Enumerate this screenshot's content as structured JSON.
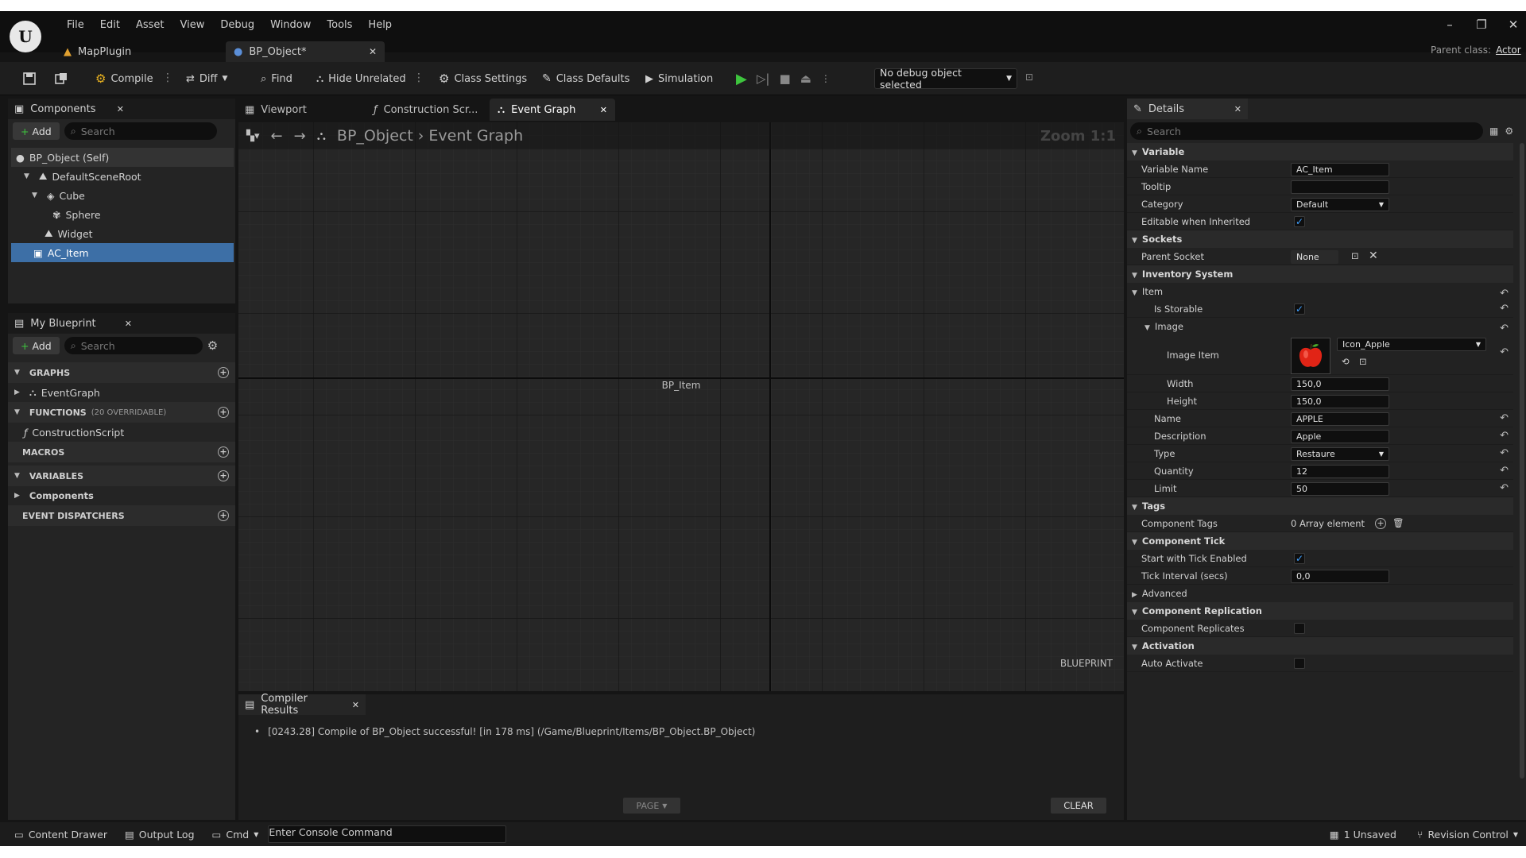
{
  "menu": [
    "File",
    "Edit",
    "Asset",
    "View",
    "Debug",
    "Window",
    "Tools",
    "Help"
  ],
  "tabs": {
    "map_plugin": "MapPlugin",
    "bp_object": "BP_Object*"
  },
  "parent_class": {
    "label": "Parent class:",
    "value": "Actor"
  },
  "toolbar": {
    "compile": "Compile",
    "diff": "Diff",
    "find": "Find",
    "hide_unrelated": "Hide Unrelated",
    "class_settings": "Class Settings",
    "class_defaults": "Class Defaults",
    "simulation": "Simulation",
    "debug_select": "No debug object selected"
  },
  "components": {
    "title": "Components",
    "add": "Add",
    "search_placeholder": "Search",
    "tree": [
      "BP_Object (Self)",
      "DefaultSceneRoot",
      "Cube",
      "Sphere",
      "Widget",
      "AC_Item"
    ]
  },
  "my_blueprint": {
    "title": "My Blueprint",
    "add": "Add",
    "search_placeholder": "Search",
    "graphs": "GRAPHS",
    "event_graph": "EventGraph",
    "functions": "FUNCTIONS",
    "functions_count": "(20 OVERRIDABLE)",
    "construction_script": "ConstructionScript",
    "macros": "MACROS",
    "variables": "VARIABLES",
    "components": "Components",
    "event_dispatchers": "EVENT DISPATCHERS"
  },
  "editor_tabs": {
    "viewport": "Viewport",
    "construction": "Construction Scr...",
    "event_graph": "Event Graph"
  },
  "graph": {
    "breadcrumb_root": "BP_Object",
    "breadcrumb_leaf": "Event Graph",
    "zoom": "Zoom 1:1",
    "watermark": "BP_Item",
    "corner": "BLUEPRINT"
  },
  "compiler": {
    "title": "Compiler Results",
    "message": "[0243.28] Compile of BP_Object successful! [in 178 ms] (/Game/Blueprint/Items/BP_Object.BP_Object)",
    "page": "PAGE",
    "clear": "CLEAR"
  },
  "details": {
    "title": "Details",
    "search_placeholder": "Search",
    "variable": "Variable",
    "variable_name_label": "Variable Name",
    "variable_name": "AC_Item",
    "tooltip_label": "Tooltip",
    "tooltip": "",
    "category_label": "Category",
    "category": "Default",
    "editable_label": "Editable when Inherited",
    "sockets": "Sockets",
    "parent_socket_label": "Parent Socket",
    "parent_socket": "None",
    "inventory": "Inventory System",
    "item": "Item",
    "is_storable": "Is Storable",
    "image": "Image",
    "image_item_label": "Image Item",
    "image_item": "Icon_Apple",
    "width_label": "Width",
    "width": "150,0",
    "height_label": "Height",
    "height": "150,0",
    "name_label": "Name",
    "name": "APPLE",
    "description_label": "Description",
    "description": "Apple",
    "type_label": "Type",
    "type": "Restaure",
    "quantity_label": "Quantity",
    "quantity": "12",
    "limit_label": "Limit",
    "limit": "50",
    "tags": "Tags",
    "component_tags_label": "Component Tags",
    "component_tags": "0 Array element",
    "component_tick": "Component Tick",
    "start_tick_label": "Start with Tick Enabled",
    "tick_interval_label": "Tick Interval (secs)",
    "tick_interval": "0,0",
    "advanced": "Advanced",
    "replication": "Component Replication",
    "replicates_label": "Component Replicates",
    "activation": "Activation",
    "auto_activate_label": "Auto Activate"
  },
  "statusbar": {
    "content_drawer": "Content Drawer",
    "output_log": "Output Log",
    "cmd": "Cmd",
    "console_placeholder": "Enter Console Command",
    "unsaved": "1 Unsaved",
    "revision": "Revision Control"
  },
  "colors": {
    "selection": "#3d6fa6",
    "play": "#3ec53e",
    "bg": "#151515",
    "check": "#3fa0ff"
  }
}
